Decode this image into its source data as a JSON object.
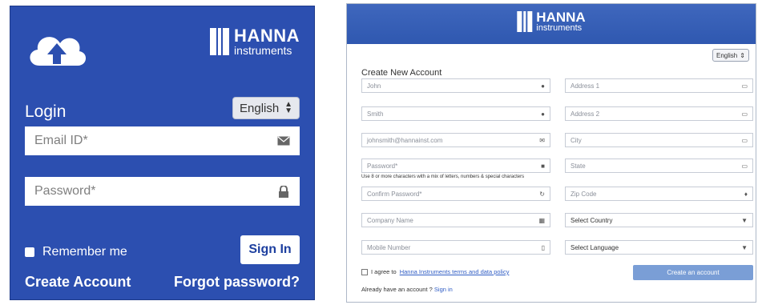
{
  "login": {
    "brand": {
      "name": "HANNA",
      "sub": "instruments"
    },
    "title": "Login",
    "language": "English",
    "email_placeholder": "Email ID*",
    "password_placeholder": "Password*",
    "remember_label": "Remember me",
    "signin_label": "Sign In",
    "create_account": "Create Account",
    "forgot_password": "Forgot password?"
  },
  "register": {
    "brand": {
      "name": "HANNA",
      "sub": "instruments"
    },
    "language": "English",
    "title": "Create New Account",
    "left_fields": [
      {
        "value": "John",
        "icon": "user-icon"
      },
      {
        "value": "Smith",
        "icon": "user-icon"
      },
      {
        "value": "johnsmith@hannainst.com",
        "icon": "email-icon"
      },
      {
        "value": "Password*",
        "icon": "lock-icon"
      },
      {
        "value": "Confirm Password*",
        "icon": "refresh-icon"
      },
      {
        "value": "Company Name",
        "icon": "building-icon"
      },
      {
        "value": "Mobile Number",
        "icon": "phone-icon"
      }
    ],
    "password_hint": "Use 8 or more characters with a mix of letters, numbers & special characters",
    "right_fields": [
      {
        "value": "Address 1",
        "icon": "card-icon"
      },
      {
        "value": "Address 2",
        "icon": "card-icon"
      },
      {
        "value": "City",
        "icon": "card-icon"
      },
      {
        "value": "State",
        "icon": "card-icon"
      },
      {
        "value": "Zip Code",
        "icon": "location-icon"
      },
      {
        "value": "Select Country",
        "icon": "chevron-down-icon"
      },
      {
        "value": "Select Language",
        "icon": "chevron-down-icon"
      }
    ],
    "agree_prefix": "I agree to",
    "agree_link": "Hanna Instruments terms and data policy",
    "create_button": "Create an account",
    "have_account": "Already have an account ?",
    "signin_link": "Sign in"
  },
  "colors": {
    "panel_blue": "#2c4fb0",
    "header_blue": "#3f67bd",
    "button_blue": "#7a9ed6",
    "link_blue": "#2f5cc4"
  }
}
